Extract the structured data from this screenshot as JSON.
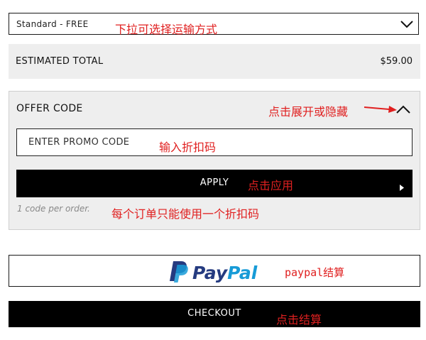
{
  "shipping": {
    "selected": "Standard - FREE",
    "annotation": "下拉可选择运输方式"
  },
  "summary": {
    "total_label": "ESTIMATED TOTAL",
    "total_value": "$59.00"
  },
  "offer": {
    "title": "OFFER CODE",
    "toggle_annotation": "点击展开或隐藏",
    "input_placeholder": "ENTER PROMO CODE",
    "input_annotation": "输入折扣码",
    "apply_label": "APPLY",
    "apply_annotation": "点击应用",
    "note": "1 code per order.",
    "note_annotation": "每个订单只能使用一个折扣码"
  },
  "paypal": {
    "logo_pay": "Pay",
    "logo_pal": "Pal",
    "annotation": "paypal结算"
  },
  "checkout": {
    "label": "CHECKOUT",
    "annotation": "点击结算"
  },
  "colors": {
    "annotation": "#e02020",
    "paypal_dark": "#253b80",
    "paypal_light": "#179bd7",
    "panel_bg": "#eeeeee"
  },
  "icons": {
    "dropdown": "chevron-down-icon",
    "toggle": "chevron-up-icon",
    "apply": "caret-right-icon",
    "paypal": "paypal-logo-icon"
  }
}
